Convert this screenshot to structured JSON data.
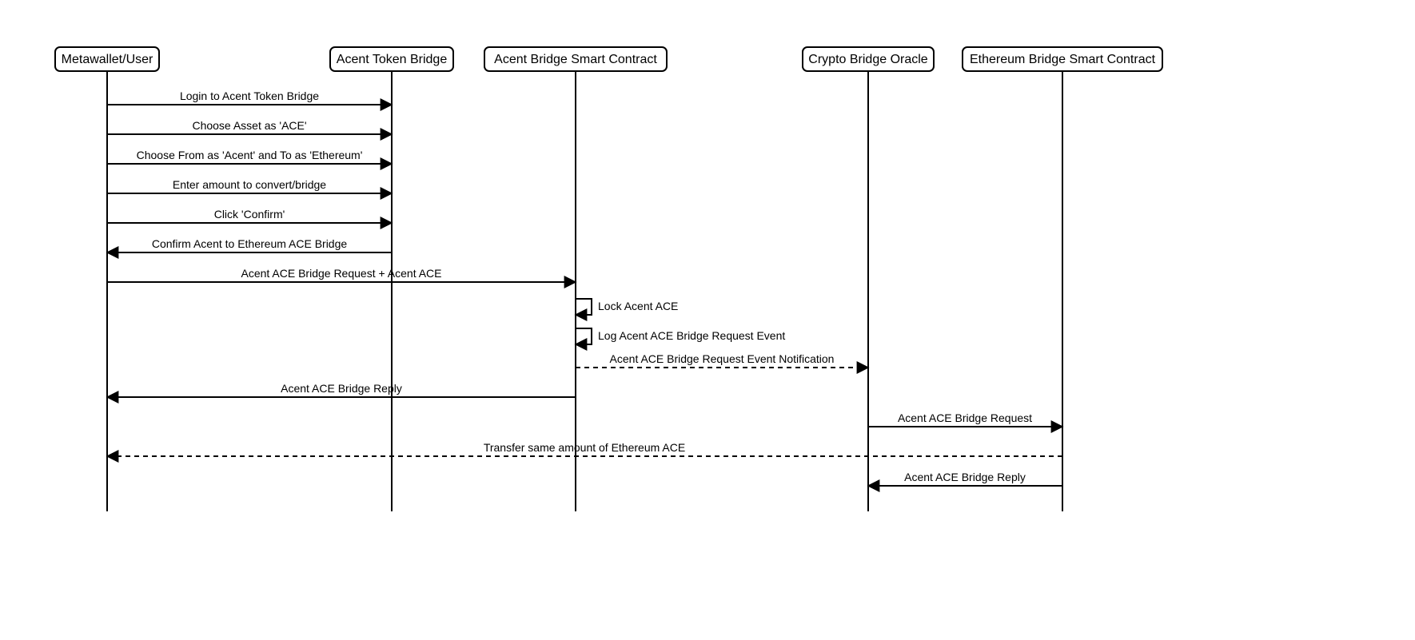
{
  "participants": {
    "p0": "Metawallet/User",
    "p1": "Acent Token Bridge",
    "p2": "Acent Bridge Smart Contract",
    "p3": "Crypto Bridge Oracle",
    "p4": "Ethereum Bridge Smart Contract"
  },
  "messages": {
    "m0": "Login to Acent Token Bridge",
    "m1": "Choose Asset as 'ACE'",
    "m2": "Choose From as 'Acent' and To as 'Ethereum'",
    "m3": "Enter amount to convert/bridge",
    "m4": "Click 'Confirm'",
    "m5": "Confirm Acent to Ethereum ACE Bridge",
    "m6": "Acent ACE Bridge Request + Acent ACE",
    "m7": "Lock Acent ACE",
    "m8": "Log Acent ACE Bridge Request Event",
    "m9": "Acent ACE Bridge Request Event Notification",
    "m10": "Acent ACE Bridge Reply",
    "m11": "Acent ACE Bridge Request",
    "m12": "Transfer same amount of Ethereum ACE",
    "m13": "Acent ACE Bridge Reply"
  },
  "chart_data": {
    "type": "sequence-diagram",
    "participants": [
      "Metawallet/User",
      "Acent Token Bridge",
      "Acent Bridge Smart Contract",
      "Crypto Bridge Oracle",
      "Ethereum Bridge Smart Contract"
    ],
    "messages": [
      {
        "from": "Metawallet/User",
        "to": "Acent Token Bridge",
        "label": "Login to Acent Token Bridge",
        "style": "solid"
      },
      {
        "from": "Metawallet/User",
        "to": "Acent Token Bridge",
        "label": "Choose Asset as 'ACE'",
        "style": "solid"
      },
      {
        "from": "Metawallet/User",
        "to": "Acent Token Bridge",
        "label": "Choose From as 'Acent' and To as 'Ethereum'",
        "style": "solid"
      },
      {
        "from": "Metawallet/User",
        "to": "Acent Token Bridge",
        "label": "Enter amount to convert/bridge",
        "style": "solid"
      },
      {
        "from": "Metawallet/User",
        "to": "Acent Token Bridge",
        "label": "Click 'Confirm'",
        "style": "solid"
      },
      {
        "from": "Acent Token Bridge",
        "to": "Metawallet/User",
        "label": "Confirm Acent to Ethereum ACE Bridge",
        "style": "solid"
      },
      {
        "from": "Metawallet/User",
        "to": "Acent Bridge Smart Contract",
        "label": "Acent ACE Bridge Request + Acent ACE",
        "style": "solid"
      },
      {
        "from": "Acent Bridge Smart Contract",
        "to": "Acent Bridge Smart Contract",
        "label": "Lock Acent ACE",
        "style": "self"
      },
      {
        "from": "Acent Bridge Smart Contract",
        "to": "Acent Bridge Smart Contract",
        "label": "Log Acent ACE Bridge Request Event",
        "style": "self"
      },
      {
        "from": "Acent Bridge Smart Contract",
        "to": "Crypto Bridge Oracle",
        "label": "Acent ACE Bridge Request Event Notification",
        "style": "dashed"
      },
      {
        "from": "Acent Bridge Smart Contract",
        "to": "Metawallet/User",
        "label": "Acent ACE Bridge Reply",
        "style": "solid"
      },
      {
        "from": "Crypto Bridge Oracle",
        "to": "Ethereum Bridge Smart Contract",
        "label": "Acent ACE Bridge Request",
        "style": "solid"
      },
      {
        "from": "Ethereum Bridge Smart Contract",
        "to": "Metawallet/User",
        "label": "Transfer same amount of Ethereum ACE",
        "style": "dashed"
      },
      {
        "from": "Ethereum Bridge Smart Contract",
        "to": "Crypto Bridge Oracle",
        "label": "Acent ACE Bridge Reply",
        "style": "solid"
      }
    ]
  }
}
